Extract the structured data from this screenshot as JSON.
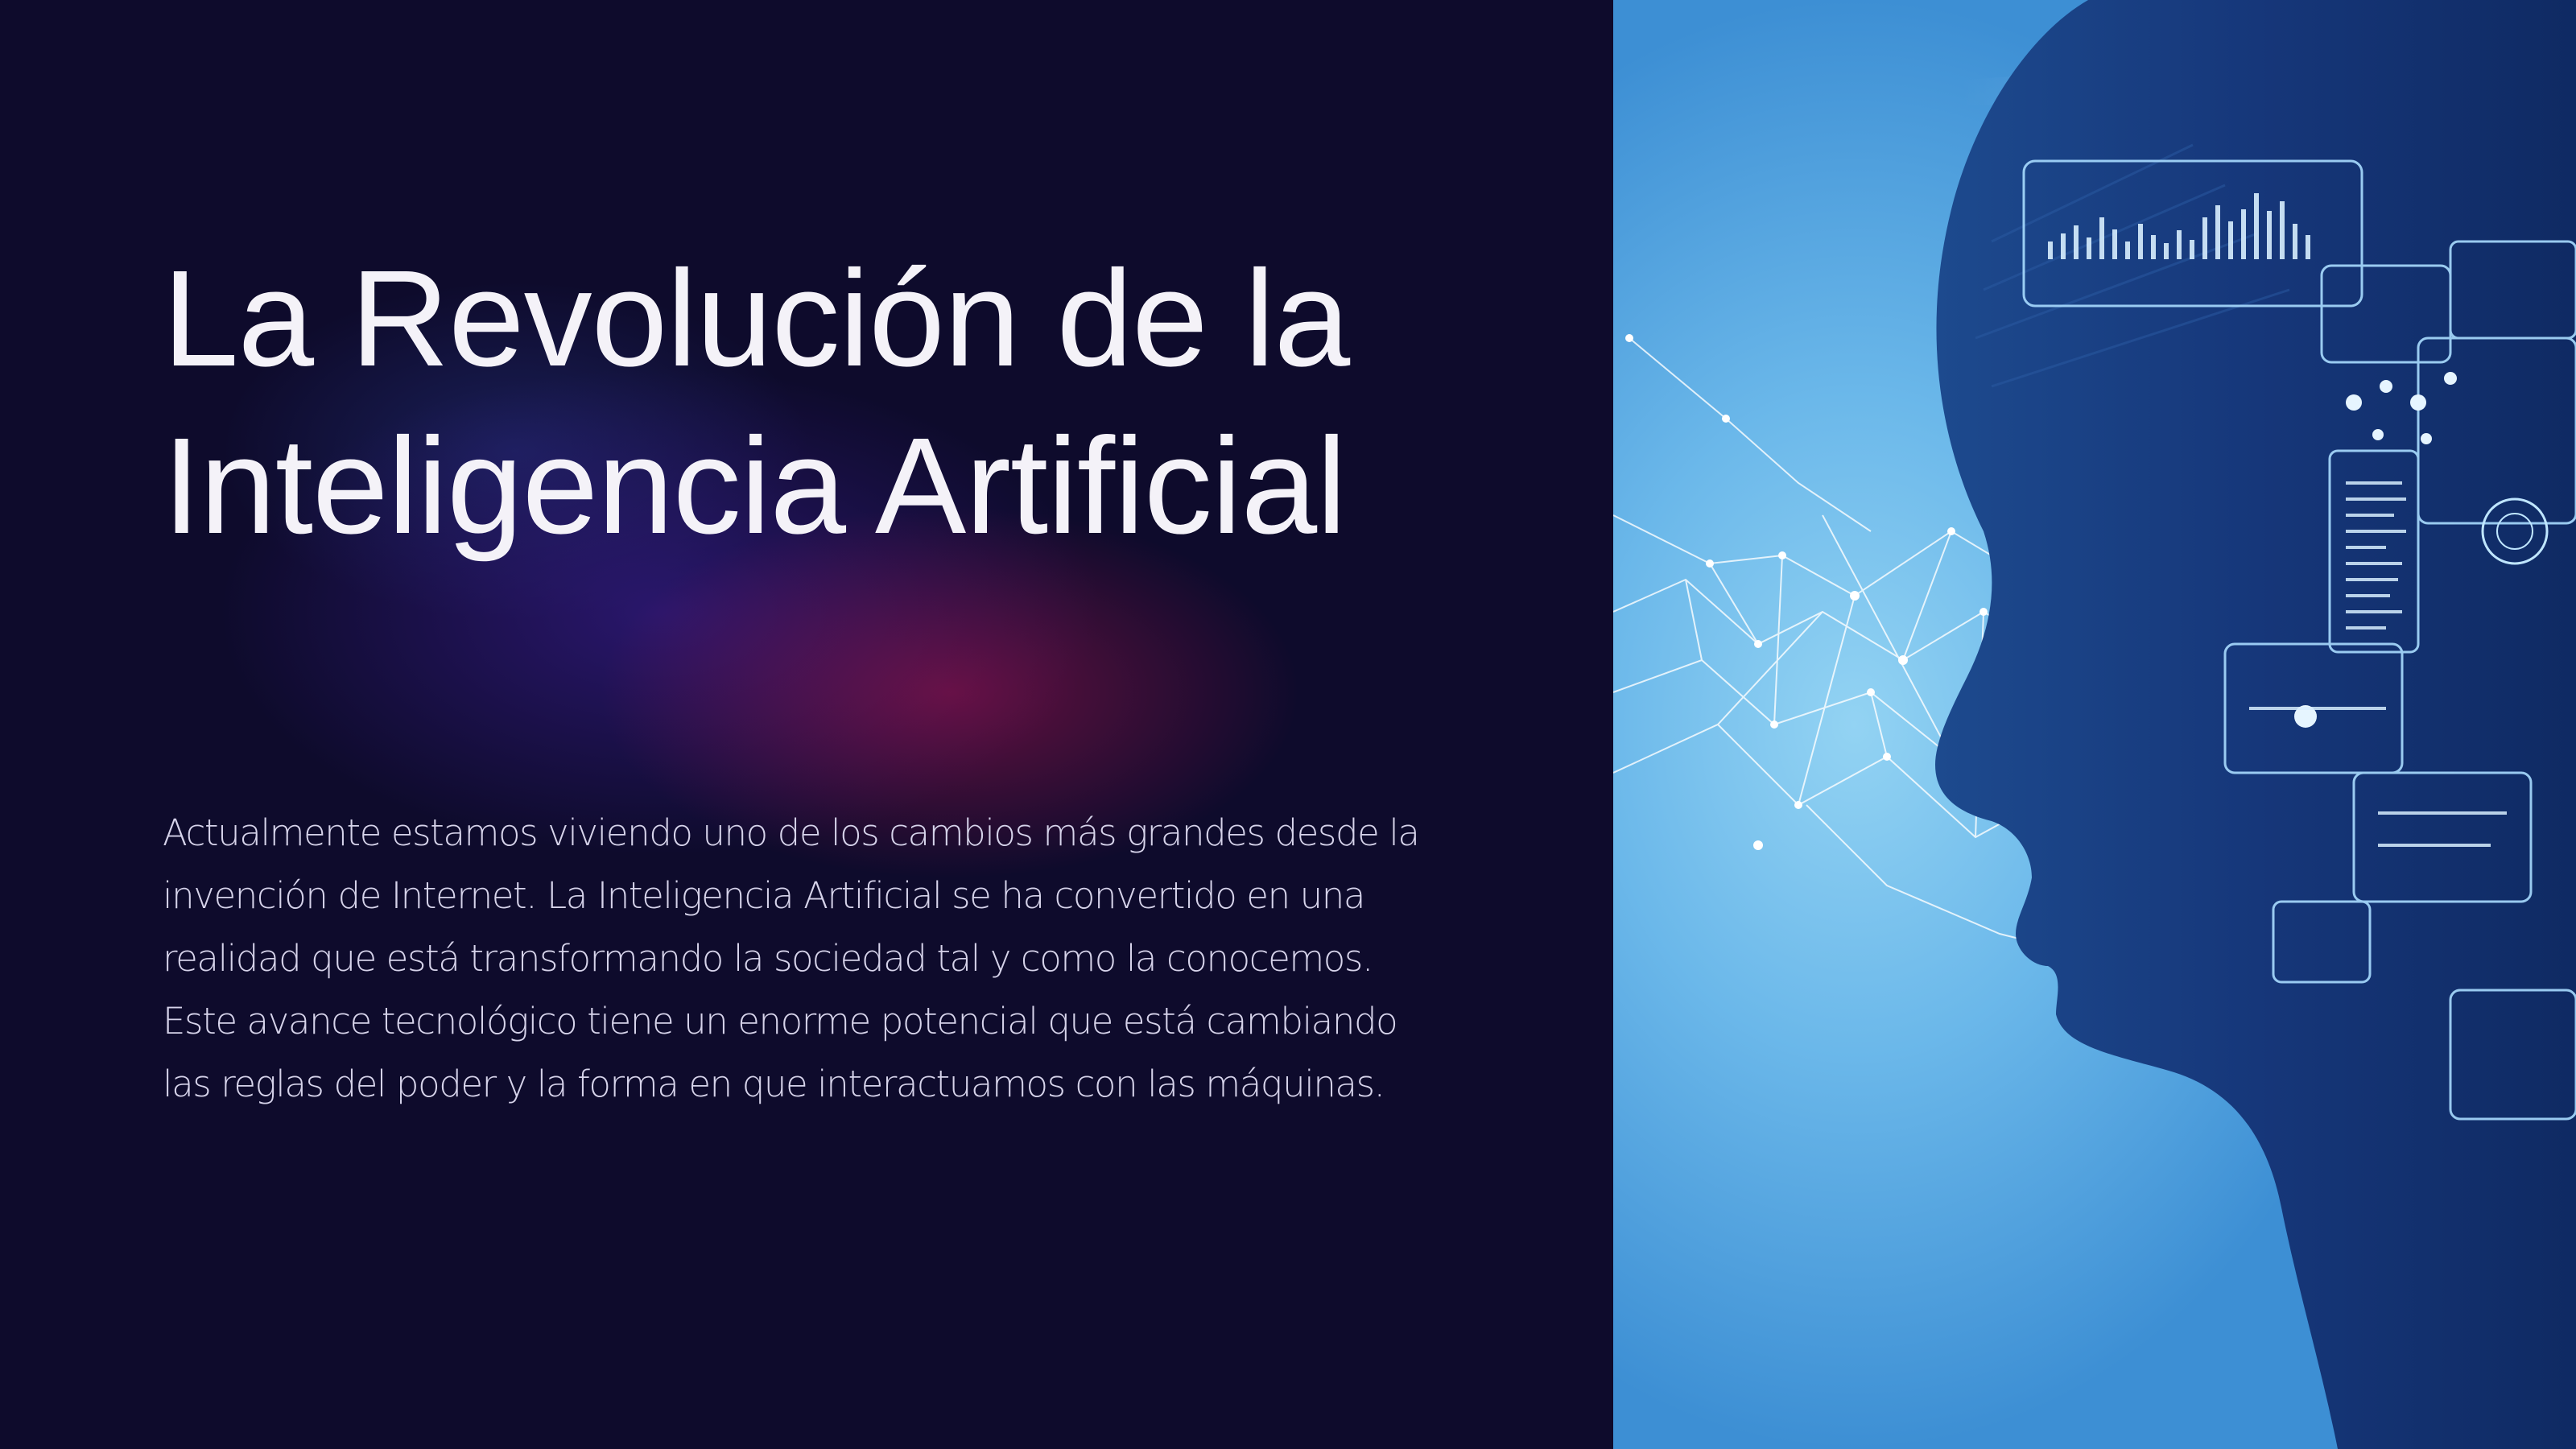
{
  "slide": {
    "title_lines": [
      "La Revolución de la",
      "Inteligencia Artificial"
    ],
    "body_lines": [
      "Actualmente estamos viviendo uno de los cambios más grandes desde la",
      "invención de Internet. La Inteligencia Artificial se ha convertido en una",
      "realidad que está transformando la sociedad tal y como la conocemos.",
      "Este avance tecnológico tiene un enorme potencial que está cambiando",
      "las reglas del poder y la forma en que interactuamos con las máquinas."
    ]
  },
  "colors": {
    "background": "#0e0b2c",
    "title": "#f4f2f8",
    "body": "#d6d3ea",
    "image_sky": "#6bb8ea",
    "silhouette": "#14306b"
  }
}
